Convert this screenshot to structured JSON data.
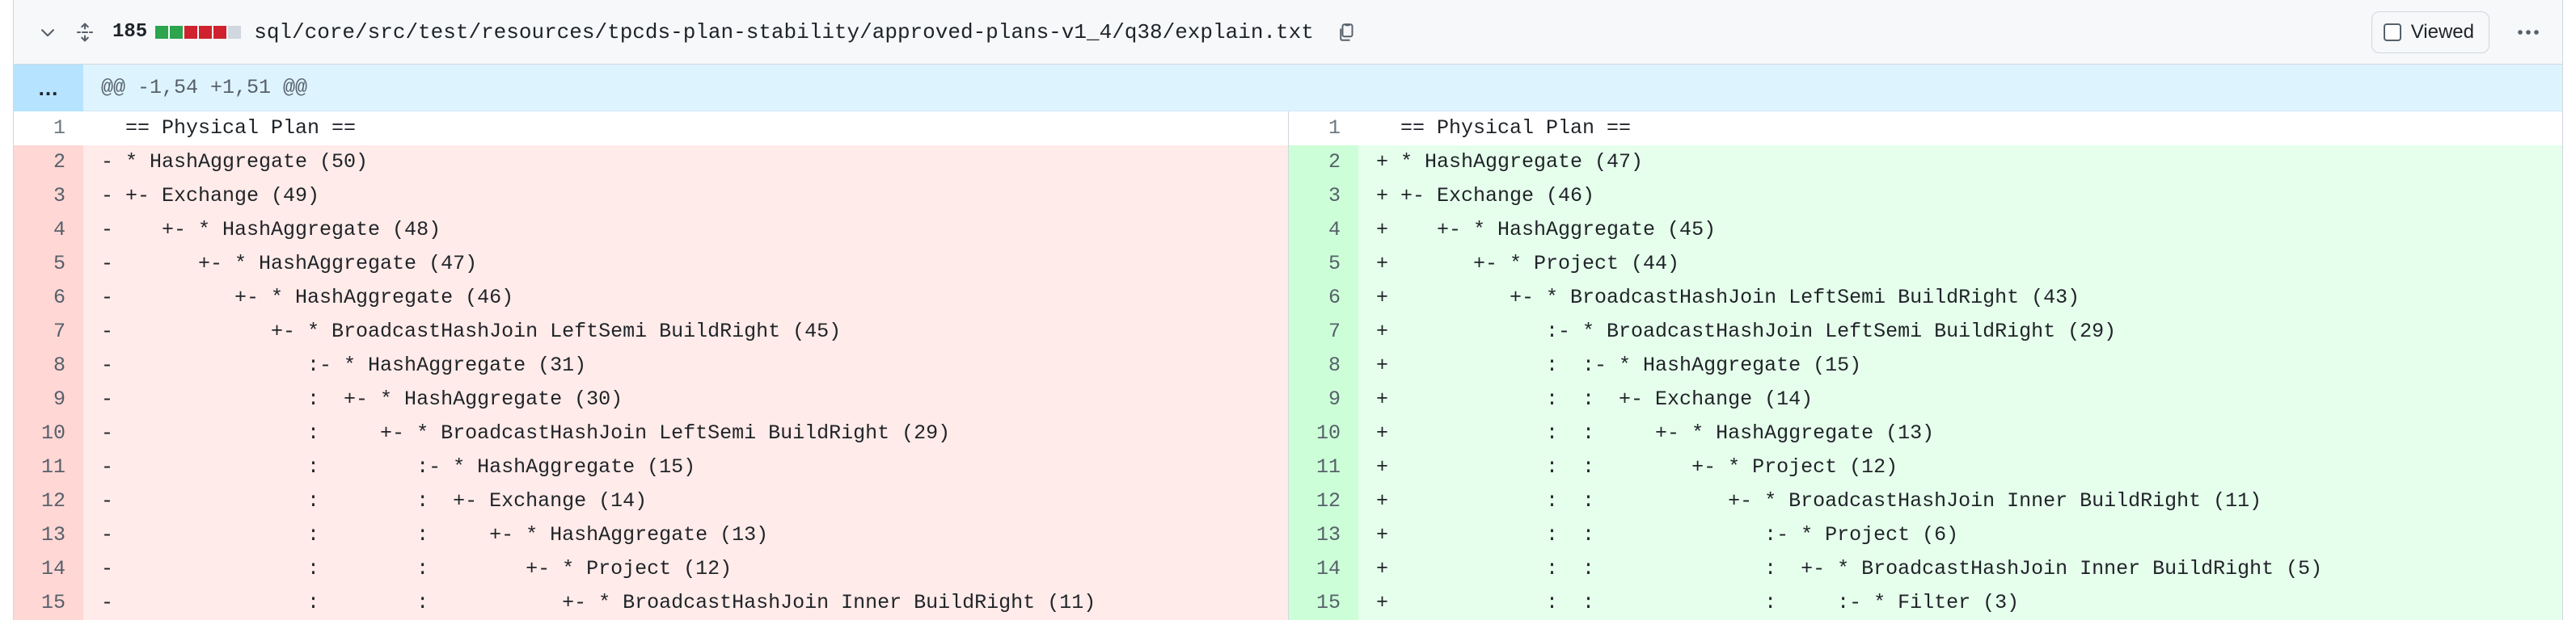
{
  "file": {
    "additions_deletions_count": "185",
    "path": "sql/core/src/test/resources/tpcds-plan-stability/approved-plans-v1_4/q38/explain.txt",
    "diffstat_colors": [
      "#2da44e",
      "#2da44e",
      "#cf222e",
      "#cf222e",
      "#cf222e",
      "#d0d7de"
    ],
    "viewed_label": "Viewed",
    "icons": {
      "collapse": "chevron-down-icon",
      "expand": "unfold-icon",
      "copy": "copy-icon",
      "more": "kebab-horizontal-icon"
    }
  },
  "hunk": {
    "expander": "...",
    "header": "@@ -1,54 +1,51 @@"
  },
  "left": [
    {
      "n": "1",
      "t": "ctx",
      "c": "  == Physical Plan =="
    },
    {
      "n": "2",
      "t": "del",
      "c": "- * HashAggregate (50)"
    },
    {
      "n": "3",
      "t": "del",
      "c": "- +- Exchange (49)"
    },
    {
      "n": "4",
      "t": "del",
      "c": "-    +- * HashAggregate (48)"
    },
    {
      "n": "5",
      "t": "del",
      "c": "-       +- * HashAggregate (47)"
    },
    {
      "n": "6",
      "t": "del",
      "c": "-          +- * HashAggregate (46)"
    },
    {
      "n": "7",
      "t": "del",
      "c": "-             +- * BroadcastHashJoin LeftSemi BuildRight (45)"
    },
    {
      "n": "8",
      "t": "del",
      "c": "-                :- * HashAggregate (31)"
    },
    {
      "n": "9",
      "t": "del",
      "c": "-                :  +- * HashAggregate (30)"
    },
    {
      "n": "10",
      "t": "del",
      "c": "-                :     +- * BroadcastHashJoin LeftSemi BuildRight (29)"
    },
    {
      "n": "11",
      "t": "del",
      "c": "-                :        :- * HashAggregate (15)"
    },
    {
      "n": "12",
      "t": "del",
      "c": "-                :        :  +- Exchange (14)"
    },
    {
      "n": "13",
      "t": "del",
      "c": "-                :        :     +- * HashAggregate (13)"
    },
    {
      "n": "14",
      "t": "del",
      "c": "-                :        :        +- * Project (12)"
    },
    {
      "n": "15",
      "t": "del",
      "c": "-                :        :           +- * BroadcastHashJoin Inner BuildRight (11)"
    }
  ],
  "right": [
    {
      "n": "1",
      "t": "ctx",
      "c": "  == Physical Plan =="
    },
    {
      "n": "2",
      "t": "add",
      "c": "+ * HashAggregate (47)"
    },
    {
      "n": "3",
      "t": "add",
      "c": "+ +- Exchange (46)"
    },
    {
      "n": "4",
      "t": "add",
      "c": "+    +- * HashAggregate (45)"
    },
    {
      "n": "5",
      "t": "add",
      "c": "+       +- * Project (44)"
    },
    {
      "n": "6",
      "t": "add",
      "c": "+          +- * BroadcastHashJoin LeftSemi BuildRight (43)"
    },
    {
      "n": "7",
      "t": "add",
      "c": "+             :- * BroadcastHashJoin LeftSemi BuildRight (29)"
    },
    {
      "n": "8",
      "t": "add",
      "c": "+             :  :- * HashAggregate (15)"
    },
    {
      "n": "9",
      "t": "add",
      "c": "+             :  :  +- Exchange (14)"
    },
    {
      "n": "10",
      "t": "add",
      "c": "+             :  :     +- * HashAggregate (13)"
    },
    {
      "n": "11",
      "t": "add",
      "c": "+             :  :        +- * Project (12)"
    },
    {
      "n": "12",
      "t": "add",
      "c": "+             :  :           +- * BroadcastHashJoin Inner BuildRight (11)"
    },
    {
      "n": "13",
      "t": "add",
      "c": "+             :  :              :- * Project (6)"
    },
    {
      "n": "14",
      "t": "add",
      "c": "+             :  :              :  +- * BroadcastHashJoin Inner BuildRight (5)"
    },
    {
      "n": "15",
      "t": "add",
      "c": "+             :  :              :     :- * Filter (3)"
    }
  ]
}
